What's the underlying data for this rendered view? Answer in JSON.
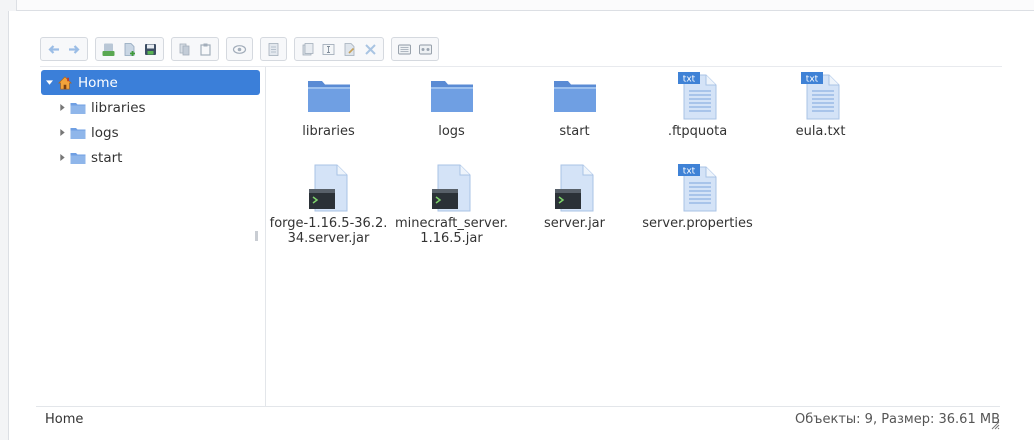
{
  "toolbar": {
    "groups": [
      [
        "back-icon",
        "forward-icon"
      ],
      [
        "upload-icon",
        "new-file-icon",
        "save-icon"
      ],
      [
        "copy-icon",
        "paste-icon"
      ],
      [
        "preview-icon"
      ],
      [
        "properties-icon"
      ],
      [
        "duplicate-icon",
        "rename-icon",
        "edit-icon",
        "extract-icon"
      ],
      [
        "view-icons-icon",
        "view-list-icon"
      ]
    ]
  },
  "tree": {
    "root_label": "Home",
    "children": [
      {
        "label": "libraries"
      },
      {
        "label": "logs"
      },
      {
        "label": "start"
      }
    ]
  },
  "files": [
    {
      "name": "libraries",
      "kind": "folder"
    },
    {
      "name": "logs",
      "kind": "folder"
    },
    {
      "name": "start",
      "kind": "folder"
    },
    {
      "name": ".ftpquota",
      "kind": "text",
      "badge": "txt"
    },
    {
      "name": "eula.txt",
      "kind": "text",
      "badge": "txt"
    },
    {
      "name": "forge-1.16.5-36.2.34.server.jar",
      "kind": "exec"
    },
    {
      "name": "minecraft_server.1.16.5.jar",
      "kind": "exec"
    },
    {
      "name": "server.jar",
      "kind": "exec"
    },
    {
      "name": "server.properties",
      "kind": "text",
      "badge": "txt"
    }
  ],
  "status": {
    "path": "Home",
    "summary": "Объекты: 9, Размер: 36.61 MB"
  },
  "colors": {
    "selection": "#3b7fd9",
    "folder": "#6f9fe3",
    "folder_dark": "#5a8bd4",
    "doc": "#d4e3f7",
    "doc_lines": "#8eb2e2"
  }
}
